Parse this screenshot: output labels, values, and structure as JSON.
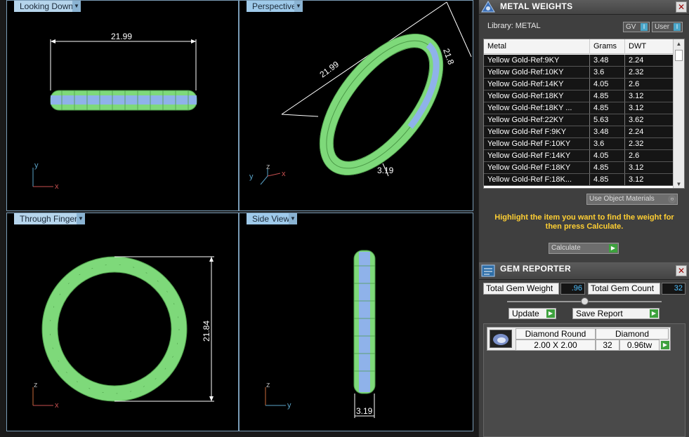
{
  "viewports": {
    "top_left": {
      "label": "Looking Down",
      "dimension": "21.99",
      "axis_v": "y",
      "axis_h": "x"
    },
    "top_right": {
      "label": "Perspective",
      "dimension_a": "21.99",
      "dimension_b": "21.8",
      "dimension_c": "3.19",
      "axis_v": "z",
      "axis_h": "x",
      "axis_d": "y"
    },
    "bottom_left": {
      "label": "Through Finger",
      "dimension": "21.84",
      "axis_v": "z",
      "axis_h": "x"
    },
    "bottom_right": {
      "label": "Side View",
      "dimension": "3.19",
      "axis_v": "z",
      "axis_h": "y"
    }
  },
  "metal_weights": {
    "title": "METAL WEIGHTS",
    "close": "✕",
    "library_label": "Library: METAL",
    "gv_label": "GV",
    "user_label": "User",
    "toggle_glyph": "I",
    "columns": [
      "Metal",
      "Grams",
      "DWT"
    ],
    "rows": [
      [
        "Yellow Gold-Ref:9KY",
        "3.48",
        "2.24"
      ],
      [
        "Yellow Gold-Ref:10KY",
        "3.6",
        "2.32"
      ],
      [
        "Yellow Gold-Ref:14KY",
        "4.05",
        "2.6"
      ],
      [
        "Yellow Gold-Ref:18KY",
        "4.85",
        "3.12"
      ],
      [
        "Yellow Gold-Ref:18KY ...",
        "4.85",
        "3.12"
      ],
      [
        "Yellow Gold-Ref:22KY",
        "5.63",
        "3.62"
      ],
      [
        "Yellow Gold-Ref F:9KY",
        "3.48",
        "2.24"
      ],
      [
        "Yellow Gold-Ref F:10KY",
        "3.6",
        "2.32"
      ],
      [
        "Yellow Gold-Ref F:14KY",
        "4.05",
        "2.6"
      ],
      [
        "Yellow Gold-Ref F:18KY",
        "4.85",
        "3.12"
      ],
      [
        "Yellow Gold-Ref F:18K...",
        "4.85",
        "3.12"
      ]
    ],
    "use_object_materials": "Use Object Materials",
    "hint": "Highlight the item you want to find the weight for then press Calculate.",
    "calculate": "Calculate"
  },
  "gem_reporter": {
    "title": "GEM REPORTER",
    "close": "✕",
    "total_weight_label": "Total Gem Weight",
    "total_weight_value": ".96",
    "total_count_label": "Total Gem Count",
    "total_count_value": "32",
    "update": "Update",
    "save_report": "Save Report",
    "gems": [
      {
        "name": "Diamond Round",
        "type": "Diamond",
        "size": "2.00 X 2.00",
        "count": "32",
        "weight": "0.96tw"
      }
    ]
  },
  "colors": {
    "ring_green": "#7ed97a",
    "band_blue": "#8fb2ea",
    "accent_yellow": "#ffcf33",
    "value_blue": "#4ec0ff"
  }
}
